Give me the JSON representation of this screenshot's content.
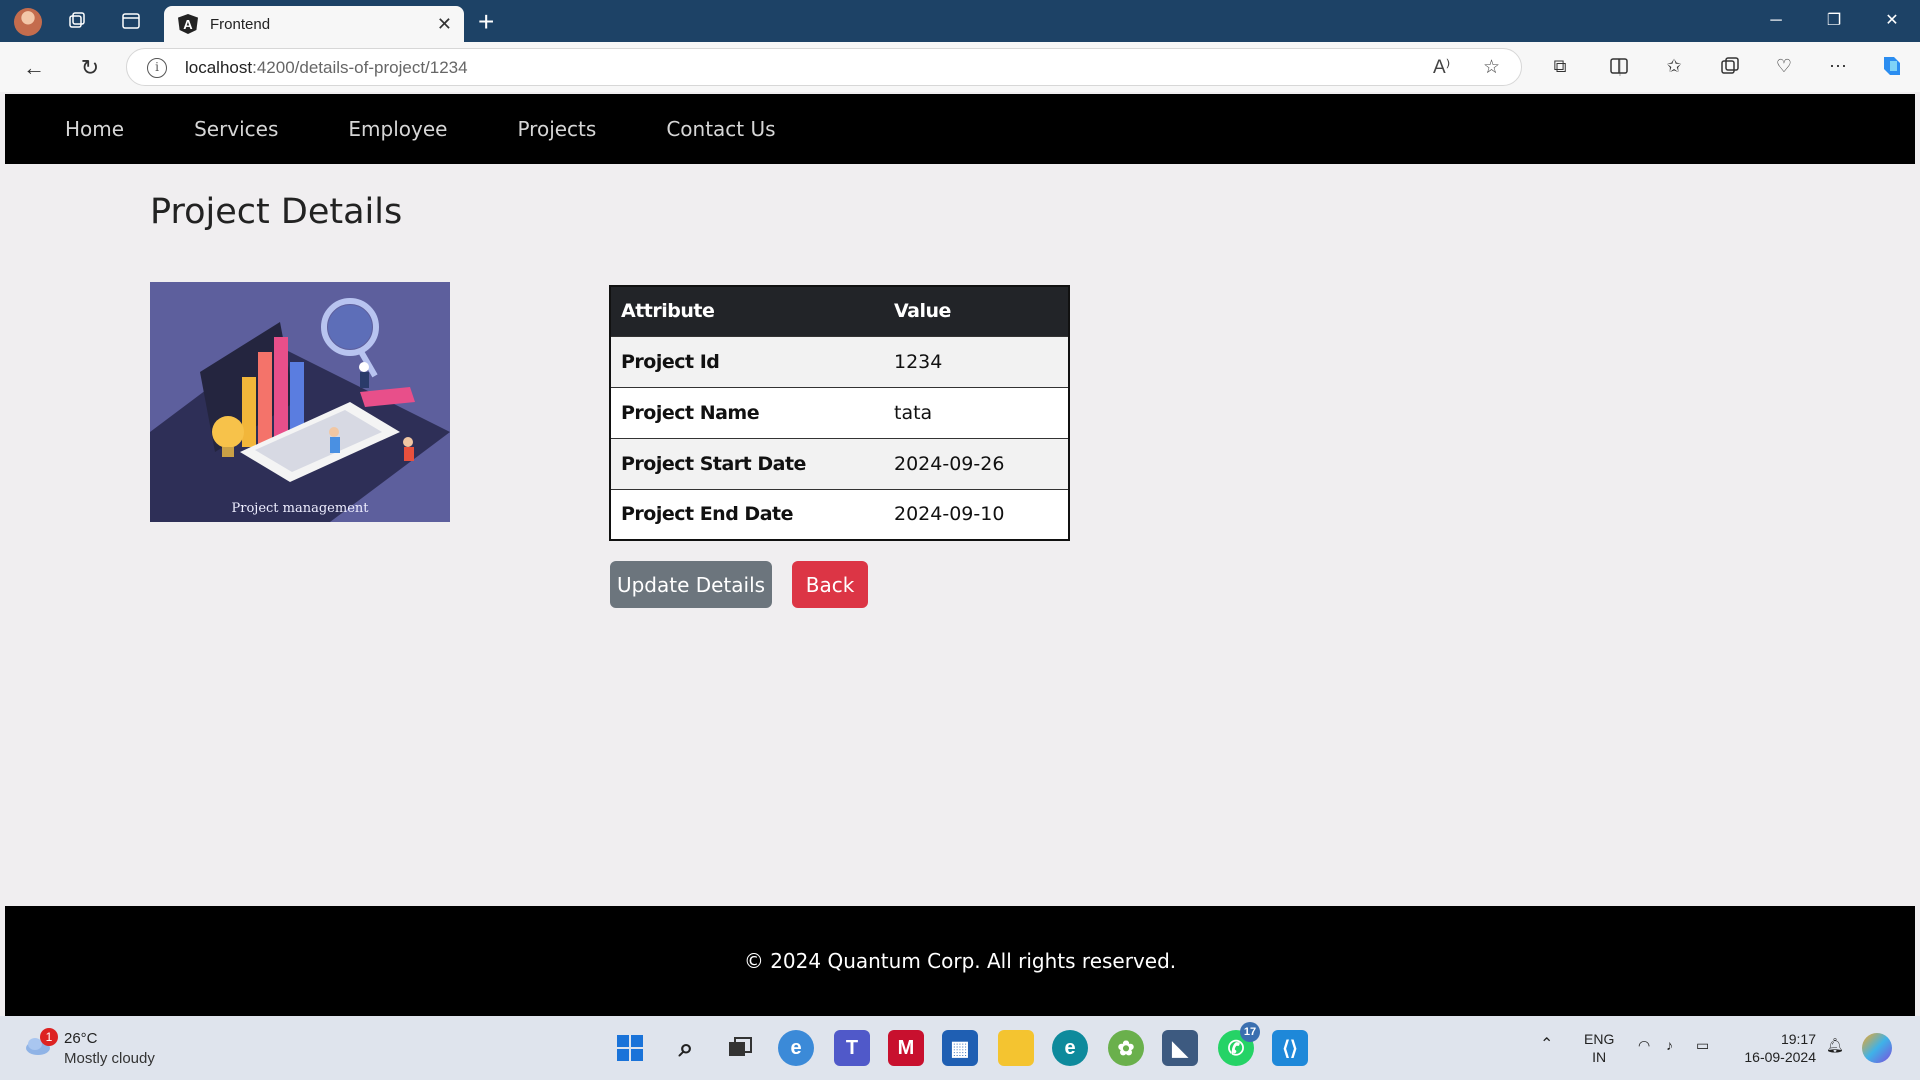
{
  "browser": {
    "tab_title": "Frontend",
    "url_host": "localhost",
    "url_path": ":4200/details-of-project/1234",
    "read_aloud_label": "A⁾"
  },
  "navbar": {
    "items": [
      "Home",
      "Services",
      "Employee",
      "Projects",
      "Contact Us"
    ]
  },
  "main": {
    "title": "Project Details",
    "image_caption": "Project management",
    "table": {
      "headers": [
        "Attribute",
        "Value"
      ],
      "rows": [
        [
          "Project Id",
          "1234"
        ],
        [
          "Project Name",
          "tata"
        ],
        [
          "Project Start Date",
          "2024-09-26"
        ],
        [
          "Project End Date",
          "2024-09-10"
        ]
      ]
    },
    "buttons": {
      "update": "Update Details",
      "back": "Back"
    }
  },
  "footer": {
    "text": "© 2024 Quantum Corp. All rights reserved."
  },
  "taskbar": {
    "weather_badge": "1",
    "temperature": "26°C",
    "weather": "Mostly cloudy",
    "whatsapp_badge": "17",
    "language_top": "ENG",
    "language_bottom": "IN",
    "time": "19:17",
    "date": "16-09-2024"
  },
  "colors": {
    "tabbar": "#1d4266",
    "navbar": "#000000",
    "update_button": "#6c757d",
    "back_button": "#dc3545",
    "table_header": "#222428"
  }
}
